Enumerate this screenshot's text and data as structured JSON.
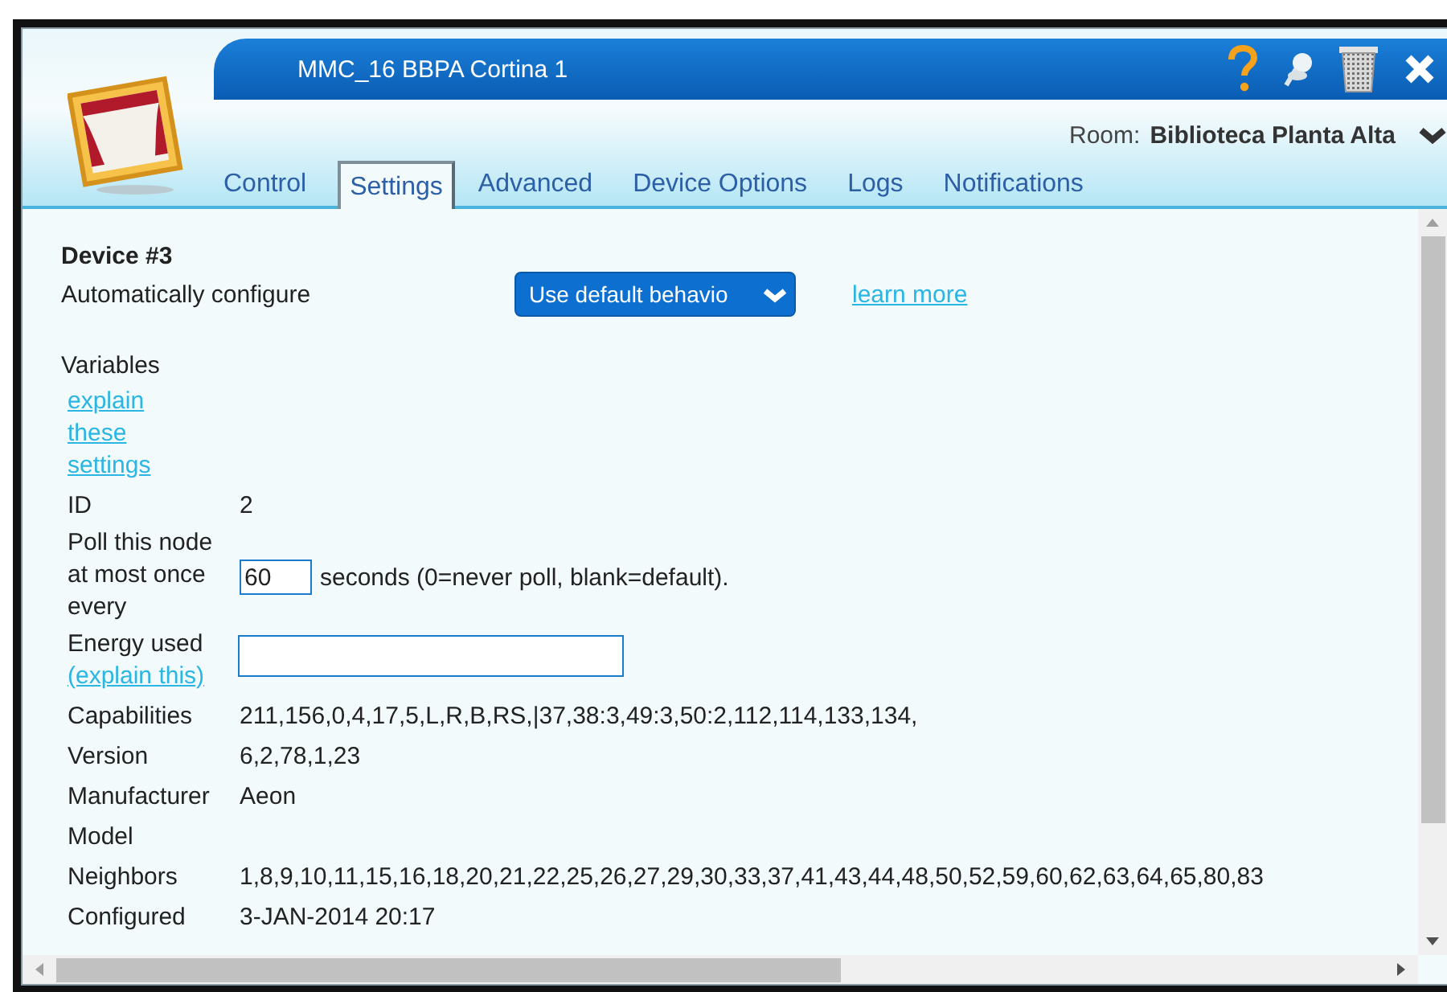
{
  "window": {
    "title": "MMC_16 BBPA Cortina 1",
    "room_label": "Room:",
    "room": "Biblioteca Planta Alta"
  },
  "tabs": [
    {
      "label": "Control",
      "selected": false
    },
    {
      "label": "Settings",
      "selected": true
    },
    {
      "label": "Advanced",
      "selected": false
    },
    {
      "label": "Device Options",
      "selected": false
    },
    {
      "label": "Logs",
      "selected": false
    },
    {
      "label": "Notifications",
      "selected": false
    }
  ],
  "device": {
    "heading": "Device #3",
    "auto_configure_label": "Automatically configure",
    "auto_configure_value": "Use default behavio",
    "learn_more": "learn more"
  },
  "variables": {
    "label": "Variables",
    "explain_link": "explain these settings"
  },
  "rows": [
    {
      "kind": "text",
      "label": "ID",
      "value": "2"
    },
    {
      "kind": "poll",
      "label": "Poll this node at most once every",
      "value": "60",
      "note": "seconds (0=never poll, blank=default)."
    },
    {
      "kind": "input",
      "label": "Energy used",
      "link": "(explain this)"
    },
    {
      "kind": "text",
      "label": "Capabilities",
      "value": "211,156,0,4,17,5,L,R,B,RS,|37,38:3,49:3,50:2,112,114,133,134,"
    },
    {
      "kind": "text",
      "label": "Version",
      "value": "6,2,78,1,23"
    },
    {
      "kind": "text",
      "label": "Manufacturer",
      "value": "Aeon"
    },
    {
      "kind": "text",
      "label": "Model"
    },
    {
      "kind": "text",
      "label": "Neighbors",
      "value": "1,8,9,10,11,15,16,18,20,21,22,25,26,27,29,30,33,37,41,43,44,48,50,52,59,60,62,63,64,65,80,83"
    },
    {
      "kind": "text",
      "label": "Configured",
      "value": "3-JAN-2014 20:17"
    }
  ]
}
